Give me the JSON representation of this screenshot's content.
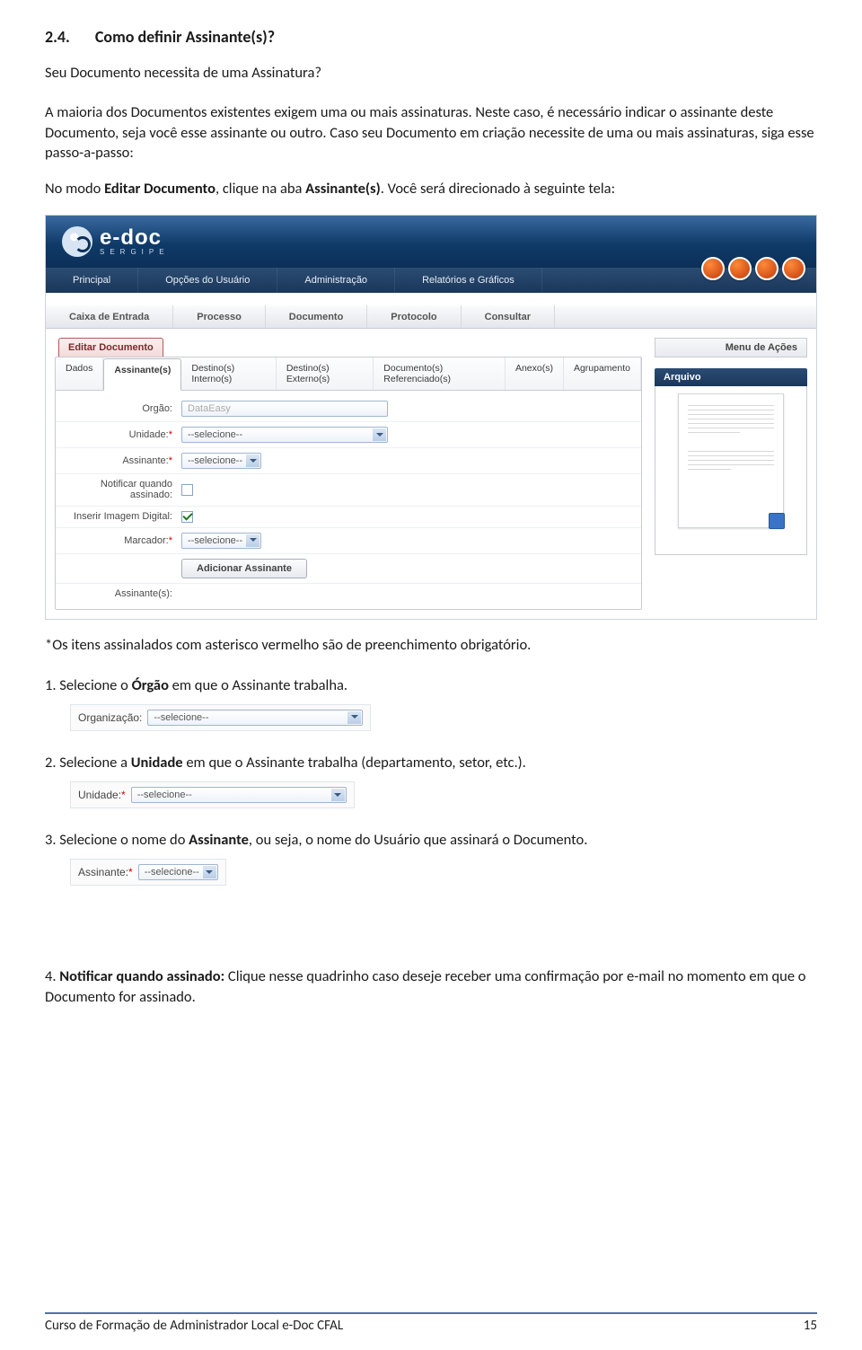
{
  "heading": {
    "num": "2.4.",
    "title": "Como definir Assinante(s)?"
  },
  "intro": {
    "question": "Seu Documento necessita de uma Assinatura?",
    "p1a": "A maioria dos Documentos existentes exigem uma ou mais assinaturas. Neste caso, é necessário indicar o assinante deste Documento, seja você esse assinante ou outro. Caso seu Documento em criação necessite de uma ou mais assinaturas, siga esse passo-a-passo:",
    "p2_prefix": "No modo ",
    "p2_bold1": "Editar Documento",
    "p2_mid": ", clique na aba ",
    "p2_bold2": "Assinante(s)",
    "p2_suffix": ". Você será direcionado à seguinte tela:"
  },
  "app": {
    "logo_big": "e-doc",
    "logo_small": "SERGIPE",
    "nav1": [
      "Principal",
      "Opções do Usuário",
      "Administração",
      "Relatórios e Gráficos"
    ],
    "nav2": [
      "Caixa de Entrada",
      "Processo",
      "Documento",
      "Protocolo",
      "Consultar"
    ],
    "menu_acoes": "Menu de Ações",
    "edit_tab": "Editar Documento",
    "arquivo": "Arquivo",
    "subtabs": [
      "Dados",
      "Assinante(s)",
      "Destino(s) Interno(s)",
      "Destino(s) Externo(s)",
      "Documento(s) Referenciado(s)",
      "Anexo(s)",
      "Agrupamento"
    ],
    "form": {
      "orgao_label": "Orgão:",
      "orgao_value": "DataEasy",
      "unidade_label": "Unidade:",
      "assinante_label": "Assinante:",
      "notificar_label": "Notificar quando assinado:",
      "imagem_label": "Inserir Imagem Digital:",
      "marcador_label": "Marcador:",
      "selecione": "--selecione--",
      "add_btn": "Adicionar Assinante",
      "assinantes_label": "Assinante(s):"
    }
  },
  "note_red": "*Os itens assinalados com asterisco vermelho são de preenchimento obrigatório.",
  "steps": {
    "s1_pre": "1.  Selecione o ",
    "s1_b": "Órgão",
    "s1_post": " em que o Assinante trabalha.",
    "s1_field_label": "Organização:",
    "s2_pre": "2.  Selecione a ",
    "s2_b": "Unidade",
    "s2_post": " em que o Assinante trabalha (departamento, setor, etc.).",
    "s2_field_label": "Unidade:",
    "s3_pre": "3.  Selecione o nome do ",
    "s3_b": "Assinante",
    "s3_post": ", ou seja, o nome do Usuário que assinará o Documento.",
    "s3_field_label": "Assinante:",
    "s4_pre": "4.  ",
    "s4_b": "Notificar quando assinado:",
    "s4_post": " Clique nesse quadrinho caso deseje receber uma confirmação por e-mail no momento em que o Documento for assinado.",
    "selecione": "--selecione--",
    "asterisk": "*"
  },
  "footer": {
    "left": "Curso de Formação de Administrador Local e-Doc CFAL",
    "right": "15"
  }
}
